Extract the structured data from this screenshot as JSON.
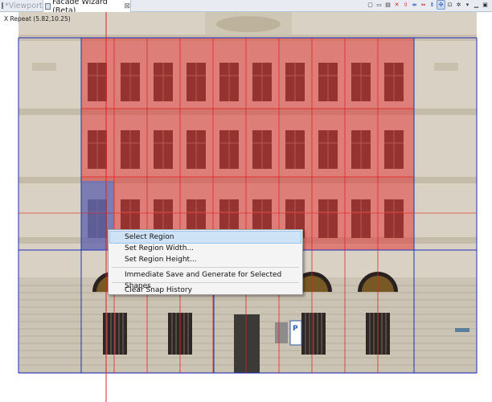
{
  "tabs": [
    {
      "label": "*Viewport",
      "active": false
    },
    {
      "label": "Facade Wizard (Beta)",
      "active": true,
      "close_glyph": "⊠"
    }
  ],
  "toolbar": [
    {
      "icon": "select-rect-icon"
    },
    {
      "icon": "open-folder-icon"
    },
    {
      "icon": "save-icon"
    },
    {
      "icon": "delete-icon"
    },
    {
      "icon": "split-horizontal-icon"
    },
    {
      "icon": "split-vertical-icon"
    },
    {
      "icon": "repeat-x-icon"
    },
    {
      "icon": "repeat-y-icon"
    },
    {
      "icon": "snap-icon",
      "selected": true
    },
    {
      "icon": "zoom-fit-icon"
    },
    {
      "icon": "settings-icon"
    },
    {
      "icon": "dropdown-arrow-icon"
    },
    {
      "icon": "minimize-icon"
    },
    {
      "icon": "maximize-icon"
    }
  ],
  "viewport": {
    "readout": "X Repeat (5.82,10.25)"
  },
  "context_menu": {
    "items": [
      {
        "label": "Select Region",
        "highlighted": true
      },
      {
        "label": "Set Region Width..."
      },
      {
        "label": "Set Region Height..."
      },
      {
        "separator": true
      },
      {
        "label": "Immediate Save and Generate for Selected Shapes"
      },
      {
        "separator": true
      },
      {
        "label": "Clear Snap History"
      }
    ]
  },
  "colors": {
    "region_red": "#e03a3a",
    "region_blue": "#3a7ad8",
    "guide_red": "#e02020",
    "guide_blue": "#2030c0",
    "facade_stone": "#d9d2c4",
    "window_dark": "#3a2a24",
    "menu_highlight": "#cfe3f7"
  }
}
